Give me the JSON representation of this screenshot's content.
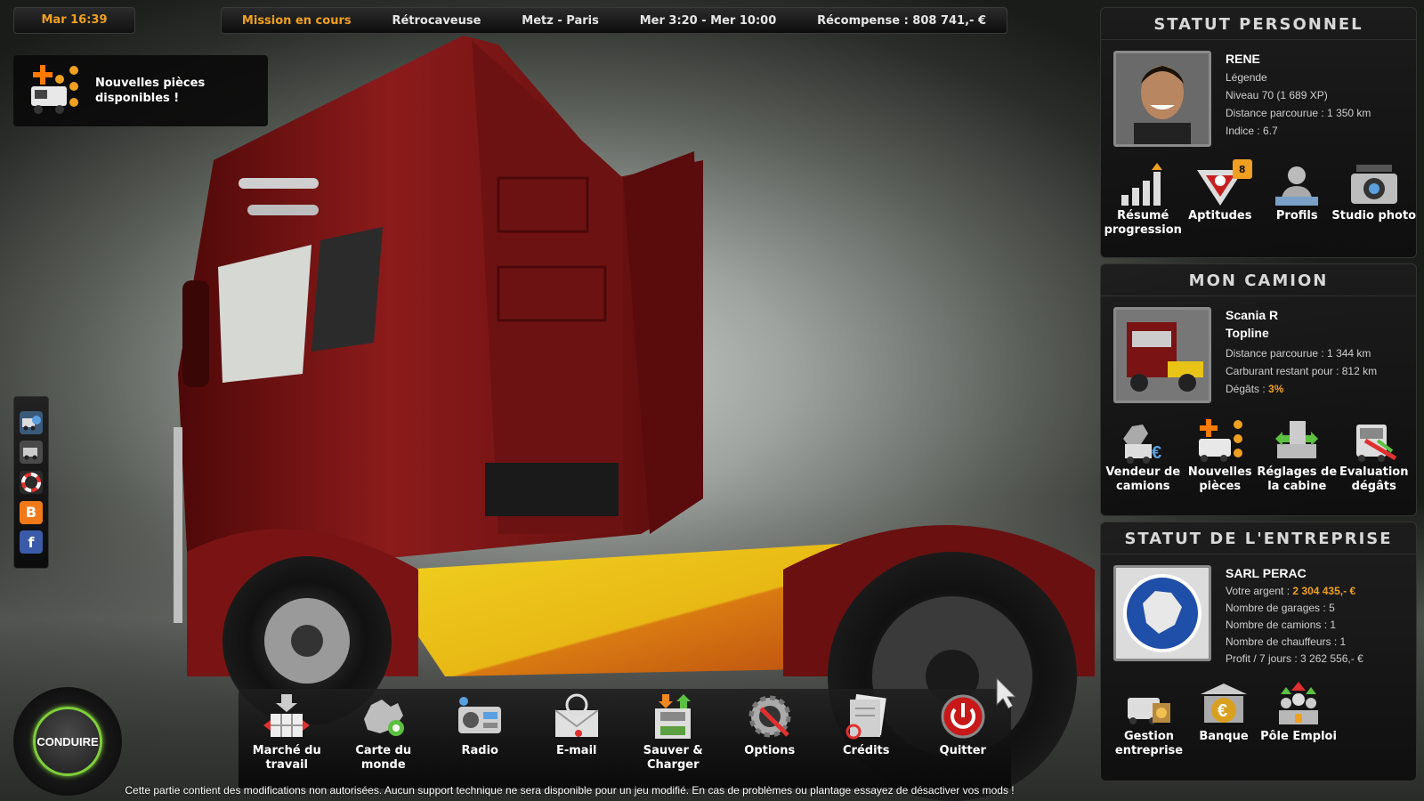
{
  "top_bar": {
    "clock": "Mar 16:39",
    "mission": {
      "status": "Mission en cours",
      "cargo": "Rétrocaveuse",
      "route": "Metz - Paris",
      "time_window": "Mer 3:20 - Mer 10:00",
      "reward": "Récompense : 808 741,- €"
    }
  },
  "notification": {
    "text_line1": "Nouvelles pièces",
    "text_line2": "disponibles !",
    "icon": "parts-icon"
  },
  "side_bar": {
    "items": [
      {
        "icon": "truck-globe-icon"
      },
      {
        "icon": "truck-driver-icon"
      },
      {
        "icon": "lifebuoy-icon"
      },
      {
        "icon": "blogger-icon",
        "glyph": "B"
      },
      {
        "icon": "facebook-icon",
        "glyph": "f"
      }
    ]
  },
  "drive_button": {
    "label": "CONDUIRE",
    "accent": "#7fcf3a"
  },
  "dock": {
    "items": [
      {
        "label1": "Marché du",
        "label2": "travail",
        "icon": "job-market-icon"
      },
      {
        "label1": "Carte du",
        "label2": "monde",
        "icon": "world-map-icon"
      },
      {
        "label1": "Radio",
        "label2": "",
        "icon": "radio-icon"
      },
      {
        "label1": "E-mail",
        "label2": "",
        "icon": "email-icon"
      },
      {
        "label1": "Sauver &",
        "label2": "Charger",
        "icon": "save-load-icon"
      },
      {
        "label1": "Options",
        "label2": "",
        "icon": "options-icon"
      },
      {
        "label1": "Crédits",
        "label2": "",
        "icon": "credits-icon"
      },
      {
        "label1": "Quitter",
        "label2": "",
        "icon": "power-icon"
      }
    ]
  },
  "footer_note": "Cette partie contient des modifications non autorisées. Aucun support technique ne sera disponible pour un jeu modifié. En cas de problèmes ou plantage essayez de désactiver vos mods !",
  "personal_status": {
    "title": "STATUT PERSONNEL",
    "name": "RENE",
    "rank": "Légende",
    "level": "Niveau 70 (1 689 XP)",
    "distance": "Distance parcourue : 1 350 km",
    "index": "Indice : 6.7",
    "buttons": [
      {
        "label1": "Résumé",
        "label2": "progression",
        "icon": "progress-chart-icon"
      },
      {
        "label1": "Aptitudes",
        "label2": "",
        "icon": "skills-icon",
        "badge": "8"
      },
      {
        "label1": "Profils",
        "label2": "",
        "icon": "profiles-icon"
      },
      {
        "label1": "Studio photo",
        "label2": "",
        "icon": "camera-icon"
      }
    ]
  },
  "my_truck": {
    "title": "MON CAMION",
    "model_line1": "Scania R",
    "model_line2": "Topline",
    "distance": "Distance parcourue : 1 344 km",
    "fuel": "Carburant restant pour : 812 km",
    "damage_label": "Dégâts : ",
    "damage_value": "3%",
    "buttons": [
      {
        "label1": "Vendeur de",
        "label2": "camions",
        "icon": "truck-dealer-icon"
      },
      {
        "label1": "Nouvelles",
        "label2": "pièces",
        "icon": "new-parts-icon"
      },
      {
        "label1": "Réglages de",
        "label2": "la cabine",
        "icon": "cabin-settings-icon"
      },
      {
        "label1": "Evaluation",
        "label2": "dégâts",
        "icon": "damage-evaluation-icon"
      }
    ]
  },
  "company_status": {
    "title": "STATUT DE L'ENTREPRISE",
    "name": "SARL PERAC",
    "money_label": "Votre argent : ",
    "money_value": "2 304 435,- €",
    "garages": "Nombre de garages : 5",
    "trucks": "Nombre de camions : 1",
    "drivers": "Nombre de chauffeurs : 1",
    "profit": "Profit / 7 jours : 3 262 556,- €",
    "buttons": [
      {
        "label1": "Gestion",
        "label2": "entreprise",
        "icon": "company-management-icon"
      },
      {
        "label1": "Banque",
        "label2": "",
        "icon": "bank-icon"
      },
      {
        "label1": "Pôle Emploi",
        "label2": "",
        "icon": "employment-icon"
      }
    ]
  },
  "colors": {
    "accent_orange": "#f0a020",
    "truck_red": "#7a1414",
    "truck_yellow": "#e8c416",
    "panel_bg": "#181818"
  }
}
